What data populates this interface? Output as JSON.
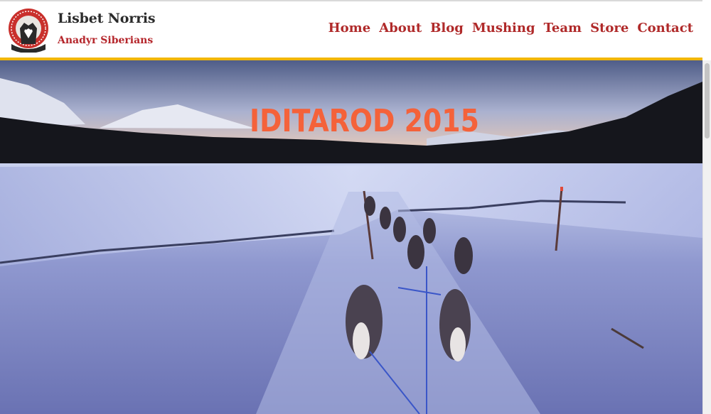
{
  "site": {
    "name": "Lisbet Norris",
    "subtitle": "Anadyr Siberians",
    "logo_icon": "husky-medallion-icon"
  },
  "nav": {
    "items": [
      {
        "label": "Home"
      },
      {
        "label": "About"
      },
      {
        "label": "Blog"
      },
      {
        "label": "Mushing"
      },
      {
        "label": "Team"
      },
      {
        "label": "Store"
      },
      {
        "label": "Contact"
      }
    ]
  },
  "hero": {
    "title": "IDITAROD 2015",
    "image_icon": "sled-dog-team-photo"
  },
  "colors": {
    "brand_red": "#b02a2a",
    "accent_yellow": "#f2b705",
    "title_orange": "#f4623a"
  }
}
